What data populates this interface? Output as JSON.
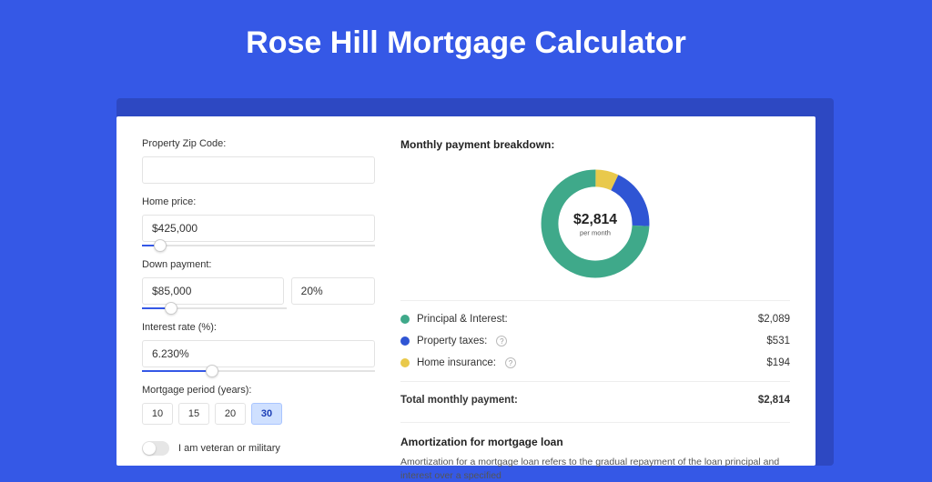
{
  "title": "Rose Hill Mortgage Calculator",
  "colors": {
    "green": "#3fa98a",
    "blue": "#2f55d4",
    "yellow": "#e9c94b"
  },
  "form": {
    "zip": {
      "label": "Property Zip Code:",
      "value": ""
    },
    "home_price": {
      "label": "Home price:",
      "value": "$425,000",
      "slider_pct": 8
    },
    "down_payment": {
      "label": "Down payment:",
      "value": "$85,000",
      "pct": "20%",
      "slider_pct": 20
    },
    "interest": {
      "label": "Interest rate (%):",
      "value": "6.230%",
      "slider_pct": 30
    },
    "period": {
      "label": "Mortgage period (years):",
      "options": [
        "10",
        "15",
        "20",
        "30"
      ],
      "selected": "30"
    },
    "veteran": {
      "label": "I am veteran or military",
      "checked": false
    }
  },
  "breakdown": {
    "title": "Monthly payment breakdown:",
    "center_value": "$2,814",
    "center_sub": "per month",
    "items": [
      {
        "label": "Principal & Interest:",
        "value": "$2,089",
        "color_key": "green",
        "info": false
      },
      {
        "label": "Property taxes:",
        "value": "$531",
        "color_key": "blue",
        "info": true
      },
      {
        "label": "Home insurance:",
        "value": "$194",
        "color_key": "yellow",
        "info": true
      }
    ],
    "total_label": "Total monthly payment:",
    "total_value": "$2,814"
  },
  "amortization": {
    "title": "Amortization for mortgage loan",
    "body": "Amortization for a mortgage loan refers to the gradual repayment of the loan principal and interest over a specified"
  },
  "chart_data": {
    "type": "pie",
    "title": "Monthly payment breakdown",
    "series": [
      {
        "name": "Principal & Interest",
        "value": 2089,
        "color": "#3fa98a"
      },
      {
        "name": "Property taxes",
        "value": 531,
        "color": "#2f55d4"
      },
      {
        "name": "Home insurance",
        "value": 194,
        "color": "#e9c94b"
      }
    ],
    "total": 2814,
    "center_label": "$2,814 per month"
  }
}
